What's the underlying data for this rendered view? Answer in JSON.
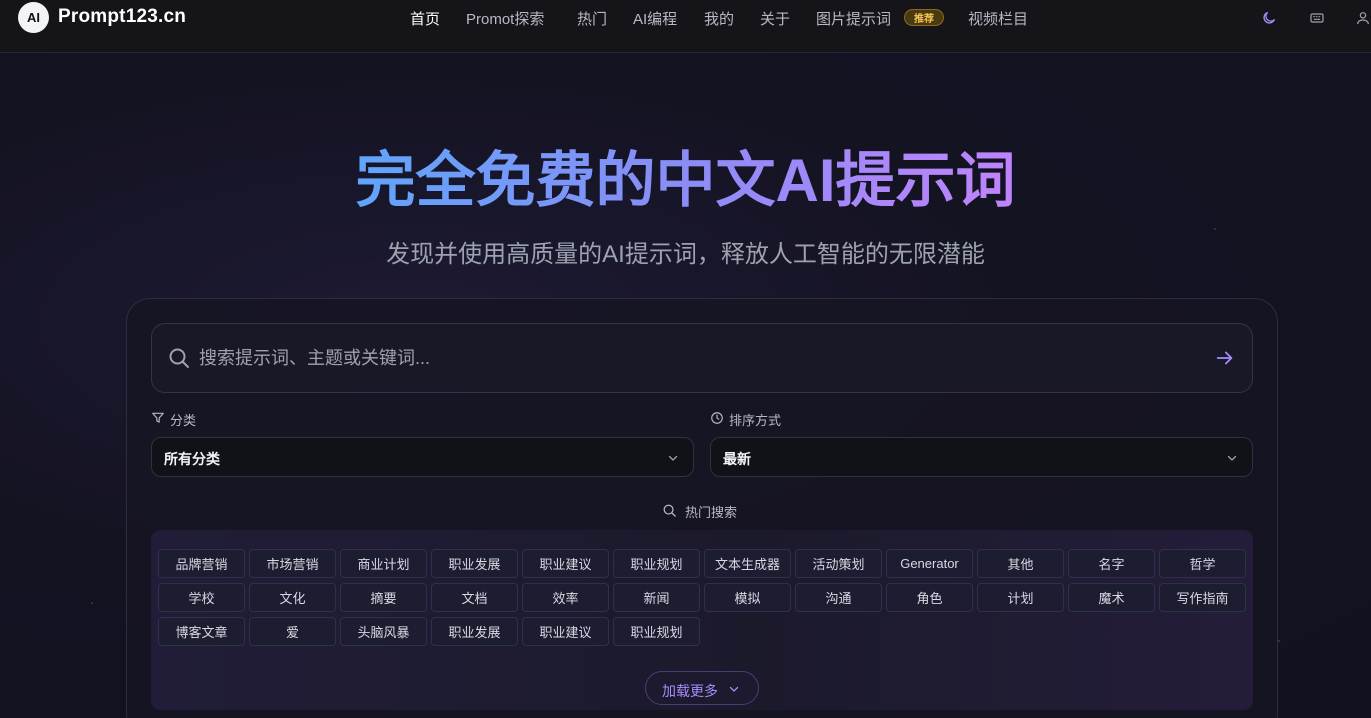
{
  "brand": {
    "logo_text": "AI",
    "name": "Prompt123.cn"
  },
  "nav": [
    {
      "label": "首页",
      "active": true
    },
    {
      "label": "Promot探索"
    },
    {
      "label": "热门"
    },
    {
      "label": "AI编程"
    },
    {
      "label": "我的"
    },
    {
      "label": "关于"
    },
    {
      "label": "图片提示词",
      "badge": "推荐"
    },
    {
      "label": "视频栏目"
    }
  ],
  "nav_icons": [
    "moon-icon",
    "keyboard-icon",
    "user-icon"
  ],
  "hero": {
    "title": "完全免费的中文AI提示词",
    "subtitle": "发现并使用高质量的AI提示词，释放人工智能的无限潜能"
  },
  "search": {
    "placeholder": "搜索提示词、主题或关键词..."
  },
  "filters": {
    "category_label": "分类",
    "category_value": "所有分类",
    "sort_label": "排序方式",
    "sort_value": "最新"
  },
  "hot": {
    "label": "热门搜索",
    "tags": [
      "品牌营销",
      "市场营销",
      "商业计划",
      "职业发展",
      "职业建议",
      "职业规划",
      "文本生成器",
      "活动策划",
      "Generator",
      "其他",
      "名字",
      "哲学",
      "学校",
      "文化",
      "摘要",
      "文档",
      "效率",
      "新闻",
      "模拟",
      "沟通",
      "角色",
      "计划",
      "魔术",
      "写作指南",
      "博客文章",
      "爱",
      "头脑风暴",
      "职业发展",
      "职业建议",
      "职业规划"
    ],
    "load_more": "加载更多"
  },
  "colors": {
    "accent": "#a78bfa",
    "gradient_start": "#60a5fa",
    "gradient_end": "#c084fc",
    "badge": "#f5c451"
  }
}
